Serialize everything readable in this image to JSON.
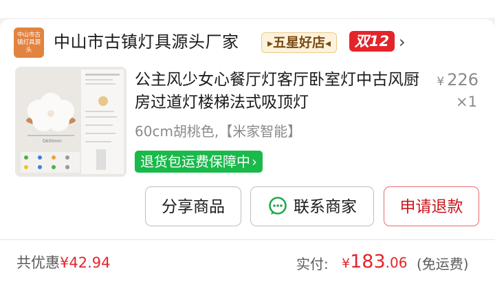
{
  "store": {
    "logo_text": "中山市古镇灯具源头",
    "name": "中山市古镇灯具源头厂家",
    "badge_rating": "五星好店",
    "badge_promo": "双12"
  },
  "product": {
    "title": "公主风少女心餐厅灯客厅卧室灯中古风厨房过道灯楼梯法式吸顶灯",
    "price_symbol": "¥",
    "price": "226",
    "quantity": "×1",
    "variant": "60cm胡桃色,【米家智能】",
    "return_guarantee": "退货包运费保障中",
    "image_caption": "D600mm"
  },
  "actions": {
    "share": "分享商品",
    "contact": "联系商家",
    "refund": "申请退款"
  },
  "summary": {
    "discount_label": "共优惠",
    "discount_value": "¥42.94",
    "paid_label": "实付:",
    "paid_symbol": "¥",
    "paid_int": "183",
    "paid_dec": ".06",
    "shipping_note": "(免运费)"
  },
  "colors": {
    "accent_red": "#e3252b",
    "guarantee_green": "#19b94a",
    "store_logo": "#e2833f"
  }
}
